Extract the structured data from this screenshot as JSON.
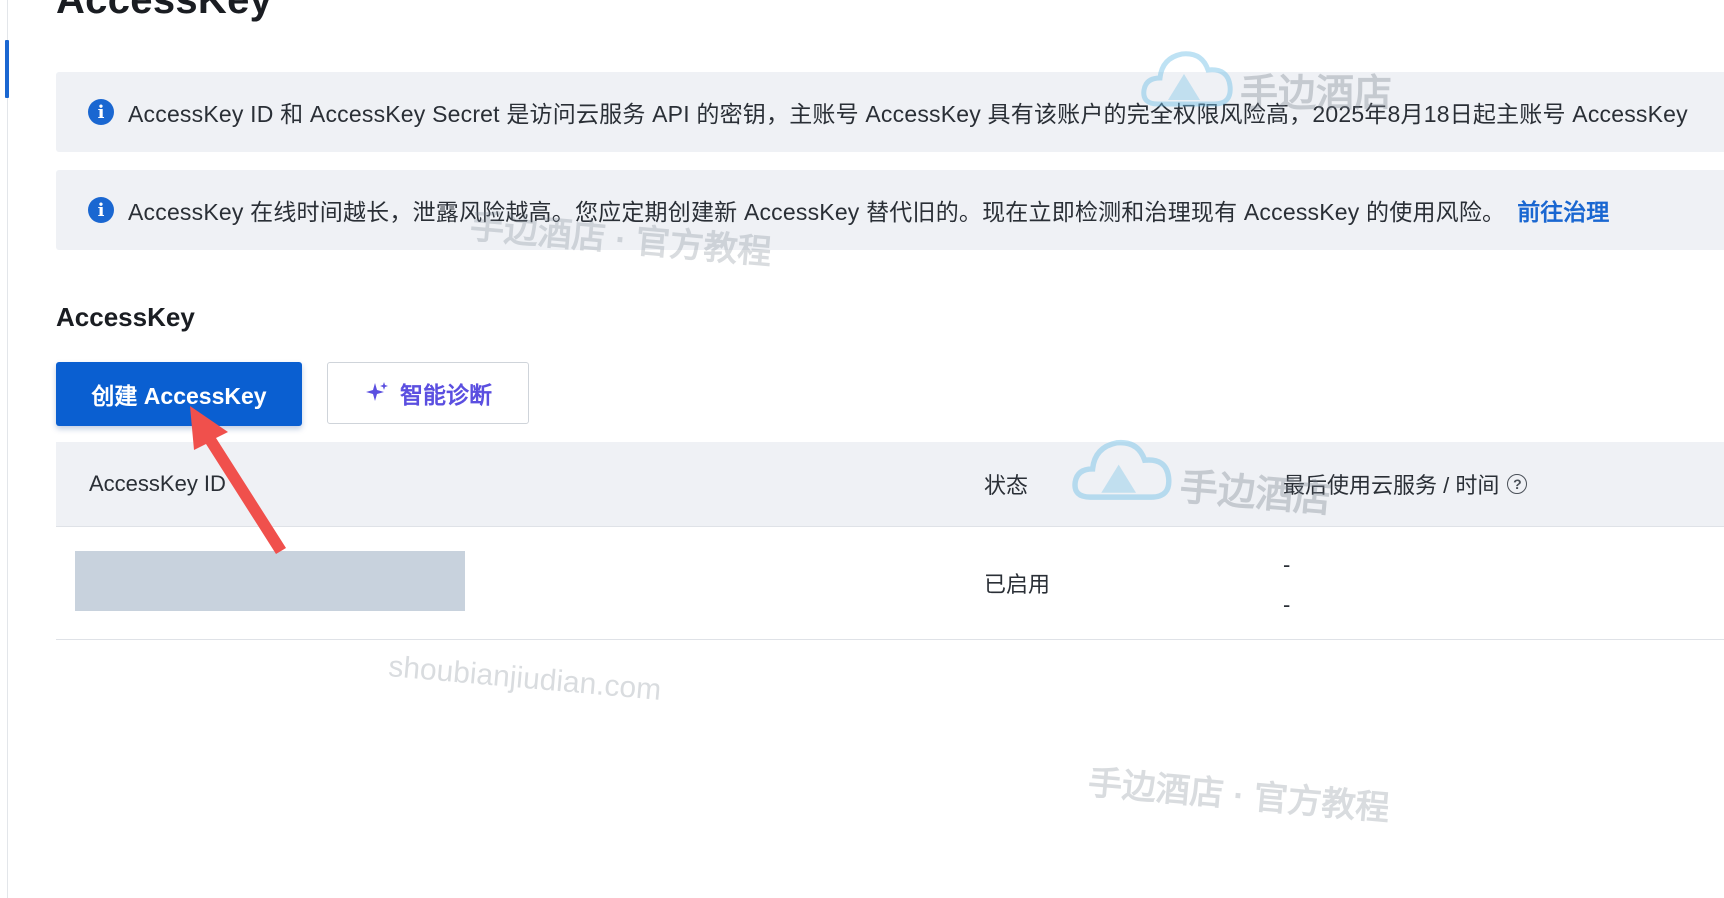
{
  "page": {
    "title": "AccessKey"
  },
  "notices": [
    {
      "text": "AccessKey ID 和 AccessKey Secret 是访问云服务 API 的密钥，主账号 AccessKey 具有该账户的完全权限风险高，2025年8月18日起主账号 AccessKey"
    },
    {
      "text": "AccessKey 在线时间越长，泄露风险越高。您应定期创建新 AccessKey 替代旧的。现在立即检测和治理现有 AccessKey 的使用风险。",
      "link": "前往治理"
    }
  ],
  "section": {
    "title": "AccessKey"
  },
  "buttons": {
    "create": "创建 AccessKey",
    "diagnose": "智能诊断"
  },
  "table": {
    "columns": {
      "id": "AccessKey ID",
      "status": "状态",
      "last_used": "最后使用云服务 / 时间"
    },
    "rows": [
      {
        "status": "已启用",
        "last_service": "-",
        "last_time": "-"
      }
    ]
  },
  "watermarks": {
    "logo_text": "手边酒店",
    "caption": "手边酒店 · 官方教程",
    "url": "shoubianjiudian.com"
  },
  "colors": {
    "primary": "#0a5fd1",
    "link": "#1a67d1",
    "ai_accent": "#5b4fe0",
    "notice_bg": "#eff1f5",
    "arrow": "#f0504c"
  }
}
